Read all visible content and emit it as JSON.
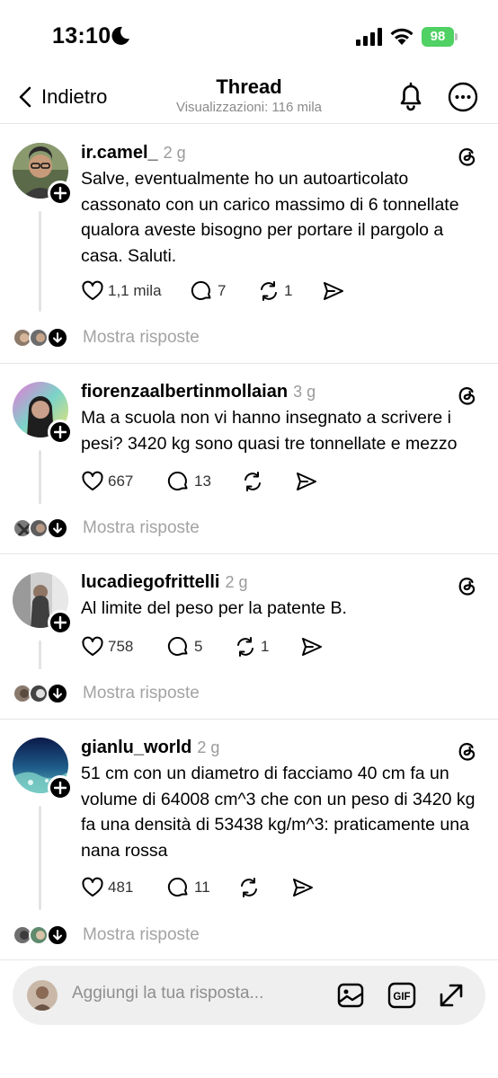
{
  "status": {
    "time": "13:10",
    "battery": "98"
  },
  "nav": {
    "back_label": "Indietro",
    "title": "Thread",
    "subtitle": "Visualizzazioni: 116 mila"
  },
  "posts": [
    {
      "username": "ir.camel_",
      "time": "2 g",
      "text": "Salve, eventualmente ho un autoarticolato cassonato con un carico massimo di 6 tonnellate qualora aveste bisogno per portare il pargolo a casa. Saluti.",
      "likes": "1,1 mila",
      "comments": "7",
      "reposts": "1",
      "show_replies": "Mostra risposte"
    },
    {
      "username": "fiorenzaalbertinmollaian",
      "time": "3 g",
      "text": "Ma a scuola non vi hanno insegnato a scrivere i pesi? 3420 kg sono quasi tre tonnellate e mezzo",
      "likes": "667",
      "comments": "13",
      "reposts": "",
      "show_replies": "Mostra risposte"
    },
    {
      "username": "lucadiegofrittelli",
      "time": "2 g",
      "text": "Al limite del peso per la patente B.",
      "likes": "758",
      "comments": "5",
      "reposts": "1",
      "show_replies": "Mostra risposte"
    },
    {
      "username": "gianlu_world",
      "time": "2 g",
      "text": "51 cm con un diametro di facciamo 40 cm fa un volume di 64008 cm^3 che con un peso di 3420 kg fa una densità di 53438 kg/m^3: praticamente una nana rossa",
      "likes": "481",
      "comments": "11",
      "reposts": "",
      "show_replies": "Mostra risposte"
    }
  ],
  "composer": {
    "placeholder": "Aggiungi la tua risposta..."
  },
  "colors": {
    "battery": "#4fd163",
    "muted": "#9a9a9a",
    "divider": "#e6e6e6"
  }
}
